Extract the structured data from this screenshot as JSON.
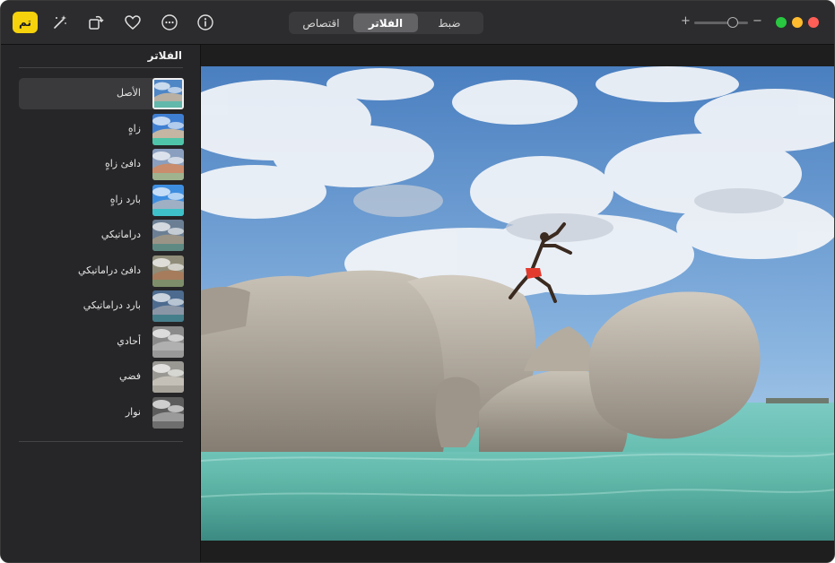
{
  "toolbar": {
    "done_label": "تم",
    "icons": [
      "magic-wand-icon",
      "rotate-icon",
      "heart-icon",
      "more-icon",
      "info-icon"
    ],
    "tabs": [
      {
        "label": "ضبط",
        "active": false
      },
      {
        "label": "الفلاتر",
        "active": true
      },
      {
        "label": "اقتصاص",
        "active": false
      }
    ],
    "zoom": {
      "plus": "+",
      "minus": "−",
      "level": 0.7
    },
    "window_controls": {
      "green": "#28c840",
      "yellow": "#febc2e",
      "red": "#ff5f57"
    },
    "accent": "#f5d20c"
  },
  "sidebar": {
    "title": "الفلاتر",
    "filters": [
      {
        "label": "الأصل",
        "selected": true,
        "tint": "none"
      },
      {
        "label": "زاهٍ",
        "selected": false,
        "tint": "vivid"
      },
      {
        "label": "دافئ زاهٍ",
        "selected": false,
        "tint": "vivid-warm"
      },
      {
        "label": "بارد زاهٍ",
        "selected": false,
        "tint": "vivid-cool"
      },
      {
        "label": "دراماتيكي",
        "selected": false,
        "tint": "dramatic"
      },
      {
        "label": "دافئ دراماتيكي",
        "selected": false,
        "tint": "dramatic-warm"
      },
      {
        "label": "بارد دراماتيكي",
        "selected": false,
        "tint": "dramatic-cool"
      },
      {
        "label": "أحادي",
        "selected": false,
        "tint": "mono"
      },
      {
        "label": "فضي",
        "selected": false,
        "tint": "silvertone"
      },
      {
        "label": "نوار",
        "selected": false,
        "tint": "noir"
      }
    ]
  },
  "photo": {
    "subject": "person jumping between large boulders at the sea"
  }
}
